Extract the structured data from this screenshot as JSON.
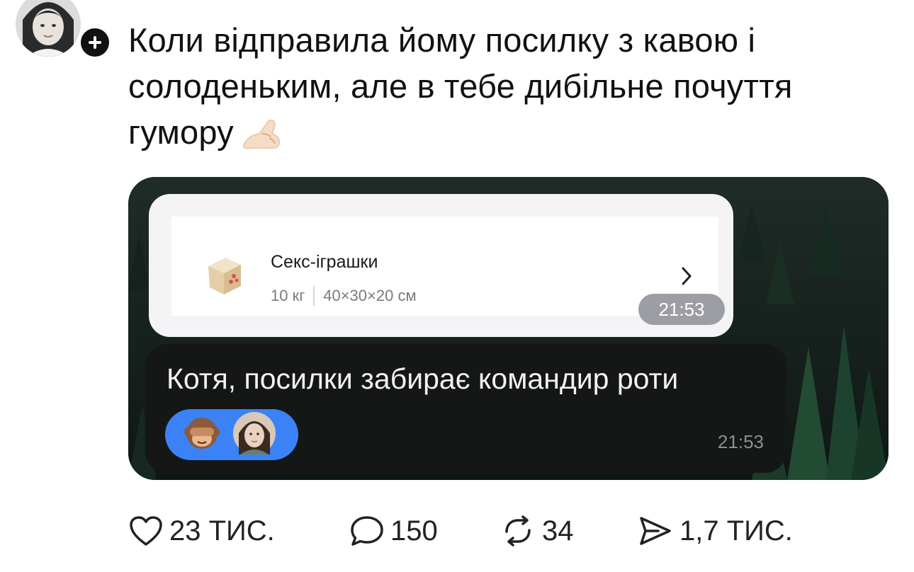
{
  "post": {
    "text": "Коли відправила йому посилку з кавою і солоденьким, але в тебе дибільне почуття гумору",
    "emoji_icon": "pinching-hand-emoji"
  },
  "avatar": {
    "icon": "user-avatar",
    "follow_icon": "plus-icon"
  },
  "screenshot": {
    "parcel": {
      "title": "Секс-іграшки",
      "weight": "10 кг",
      "dimensions": "40×30×20 см",
      "icon": "parcel-box-icon",
      "time": "21:53"
    },
    "reply": {
      "text": "Котя, посилки забирає командир роти",
      "time": "21:53",
      "reaction_emoji": "see-no-evil-monkey",
      "reaction_avatar": "user-avatar"
    }
  },
  "actions": {
    "likes": "23 ТИС.",
    "comments": "150",
    "reposts": "34",
    "shares": "1,7 ТИС."
  },
  "colors": {
    "text": "#111111",
    "reaction_pill": "#3b82f6",
    "dark_bubble": "#141716",
    "time_pill": "#9c9ea3"
  }
}
